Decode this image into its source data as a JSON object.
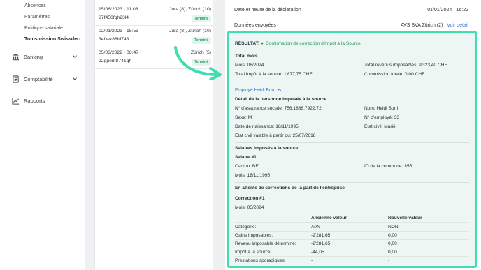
{
  "sidebar": {
    "sub_items": [
      "Absences",
      "Paramètres",
      "Politique salariale",
      "Transmission Swissdec"
    ],
    "nav": [
      {
        "label": "Banking",
        "icon": "bank-icon"
      },
      {
        "label": "Comptabilité",
        "icon": "ledger-icon"
      },
      {
        "label": "Rapports",
        "icon": "chart-line-icon"
      }
    ]
  },
  "list": {
    "rows": [
      {
        "date": "15/06/2023 · 11:03",
        "id": "87f456fgh23l4",
        "location": "Jura (8), Zürich (10)",
        "status": "Terminé"
      },
      {
        "date": "02/01/2023 · 15:53",
        "id": "34fiwk88ld748",
        "location": "Jura (8), Zürich (10)",
        "status": "Terminé"
      },
      {
        "date": "05/03/2022 · 08:47",
        "id": "22gpem8741gh",
        "location": "Zürich (5)",
        "status": "Terminé"
      }
    ]
  },
  "detail": {
    "declaration_label": "Date et heure de la déclaration",
    "declaration_value": "01/01/2024 · 16:22",
    "sent_label": "Données envoyées",
    "sent_value": "AVS SVA Zürich (2)",
    "see_detail": "Voir detail"
  },
  "result": {
    "label": "RÉSULTAT:",
    "status_dot": "●",
    "status": "Confirmation de correction d'Impôt à la Source",
    "total_mois": "Total mois",
    "mois": "Mois: 06/2024",
    "total_revenus": "Total revenus imposables: 9'323,40 CHF",
    "total_impot": "Total Impôt à la source: 1'877,75 CHF",
    "commission": "Commission totale: 0,00 CHF",
    "employee_link": "Employé Heidi Burri",
    "person_header": "Détail de la personne imposée à la source",
    "avs": "N° d'assurance sociale: 756.1886.7922.72",
    "nom": "Nom: Heidi Burri",
    "sexe": "Sexe: M",
    "employe_no": "N° d'employé: 33",
    "naissance": "Date de naissance: 18/11/1995",
    "etat_civil": "État civil: Marié",
    "etat_civil_valable": "État civil valable à partir du: 25/07/2018",
    "salaires_header": "Salaires imposés à la source",
    "salaire_1": "Salaire #1",
    "canton": "Canton: BE",
    "commune": "ID de la commune: 355",
    "salaire_mois": "Mois: 18/11/1995",
    "corrections_header": "En attente de corrections de la part de l'entreprise",
    "correction_1": "Correction #1",
    "correction_mois": "Mois: 05/2024",
    "col_old": "Ancienne valeur",
    "col_new": "Nouvelle valeur",
    "table": [
      {
        "label": "Catégorie:",
        "old": "A0N",
        "new": "NON"
      },
      {
        "label": "Gains imposables:",
        "old": "-2'281,65",
        "new": "0,00"
      },
      {
        "label": "Revenu imposable déterminé:",
        "old": "-2'281,65",
        "new": "0,00"
      },
      {
        "label": "Impôt à la source:",
        "old": "-44,05",
        "new": "0,00"
      },
      {
        "label": "Prestations sporadiques:",
        "old": "-",
        "new": "-"
      }
    ]
  },
  "colors": {
    "accent": "#40ddb0",
    "success": "#1d9a63",
    "link": "#2d6fd6"
  }
}
